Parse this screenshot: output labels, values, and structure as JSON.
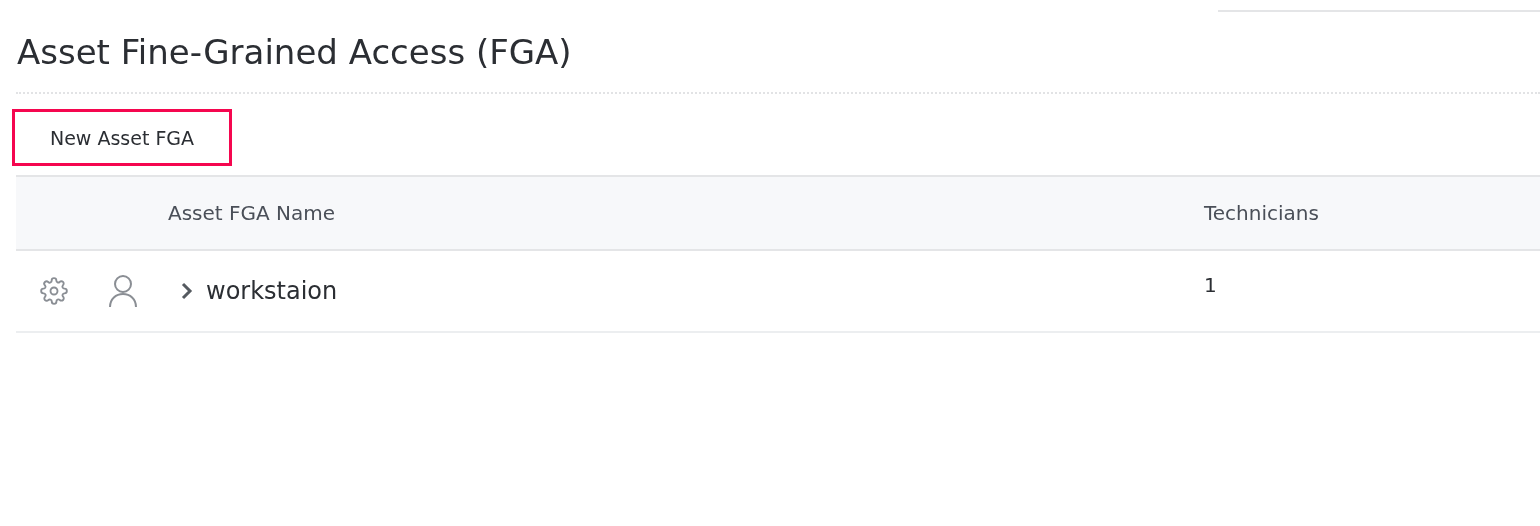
{
  "page_title": "Asset Fine-Grained Access (FGA)",
  "new_button": {
    "label": "New Asset FGA",
    "highlighted": true
  },
  "table": {
    "columns": [
      "Asset FGA Name",
      "Technicians"
    ],
    "rows": [
      {
        "name": "workstaion",
        "technicians": "1",
        "expanded": false
      }
    ]
  }
}
